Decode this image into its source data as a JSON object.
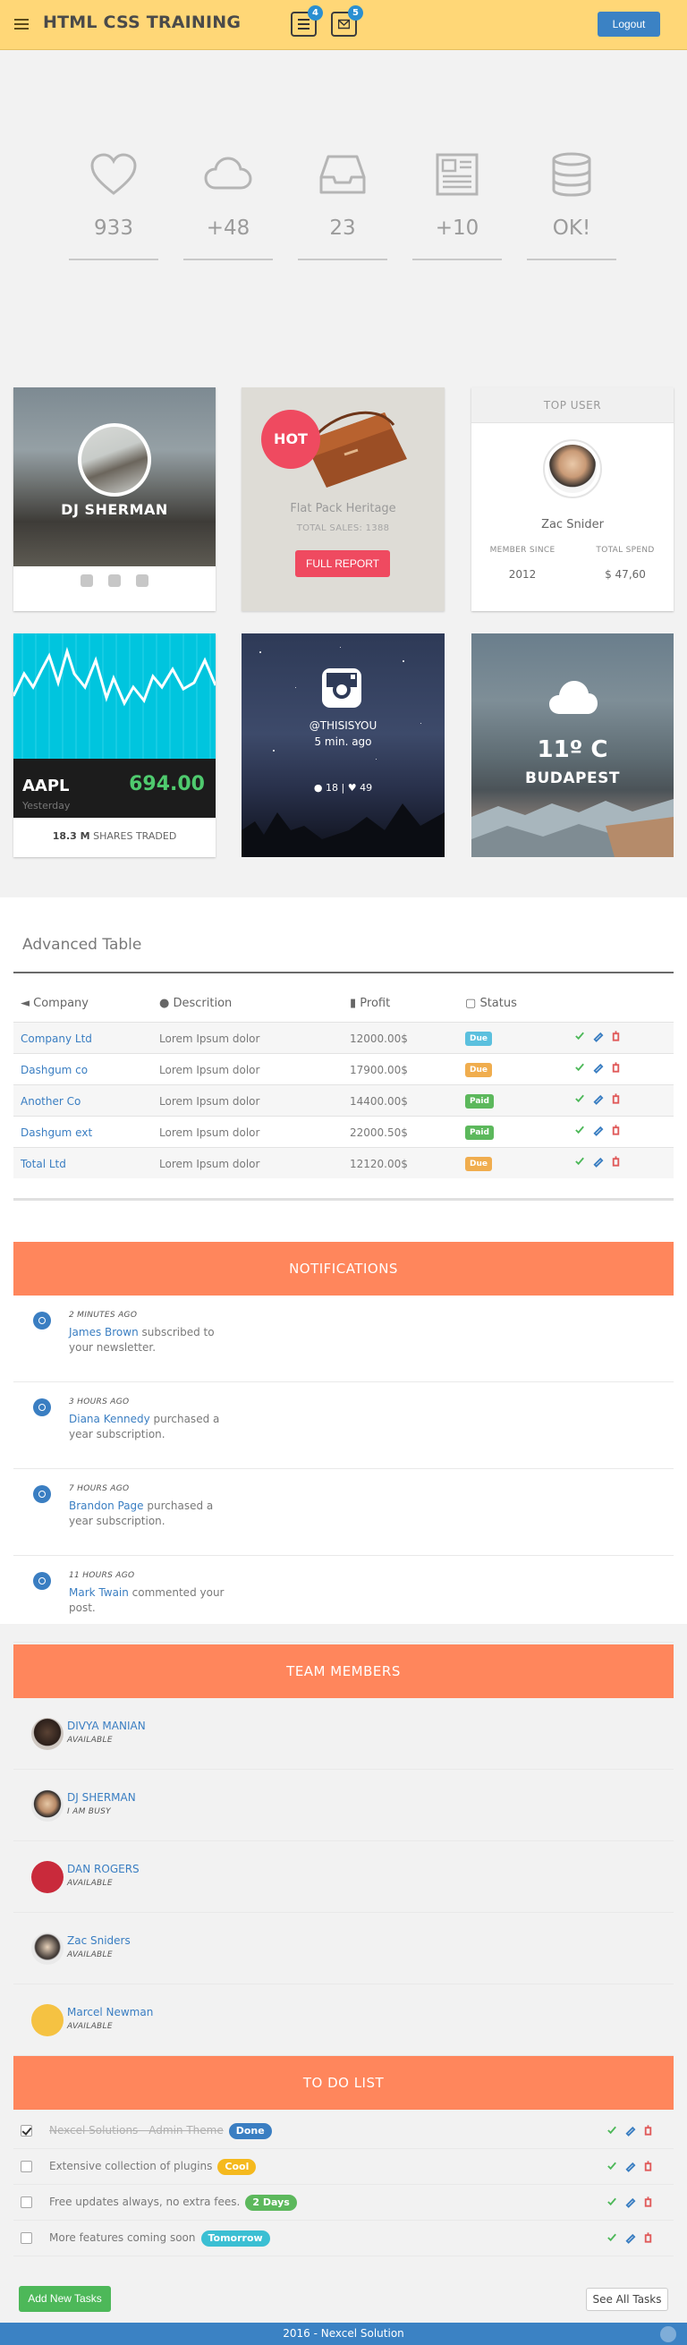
{
  "header": {
    "title": "HTML CSS TRAINING",
    "tasks_count": "4",
    "mail_count": "5",
    "logout_label": "Logout"
  },
  "stats": [
    {
      "icon": "heart-icon",
      "value": "933"
    },
    {
      "icon": "cloud-icon",
      "value": "+48"
    },
    {
      "icon": "inbox-icon",
      "value": "23"
    },
    {
      "icon": "newspaper-icon",
      "value": "+10"
    },
    {
      "icon": "database-icon",
      "value": "OK!"
    }
  ],
  "profile": {
    "name": "DJ SHERMAN"
  },
  "product": {
    "badge": "HOT",
    "title": "Flat Pack Heritage",
    "sales": "TOTAL SALES: 1388",
    "button": "FULL REPORT"
  },
  "top_user": {
    "header": "TOP USER",
    "name": "Zac Snider",
    "member_since_label": "MEMBER SINCE",
    "member_since": "2012",
    "total_spend_label": "TOTAL SPEND",
    "total_spend": "$ 47,60"
  },
  "stock": {
    "symbol": "AAPL",
    "price": "694.00",
    "period": "Yesterday",
    "shares_value": "18.3 M",
    "shares_label": "SHARES TRADED"
  },
  "instagram": {
    "handle": "@THISISYOU",
    "time": "5 min. ago",
    "comments": "18",
    "likes": "49"
  },
  "weather": {
    "temp": "11º C",
    "city": "BUDAPEST"
  },
  "table": {
    "title": "Advanced Table",
    "headers": [
      "Company",
      "Descrition",
      "Profit",
      "Status"
    ],
    "rows": [
      {
        "company": "Company Ltd",
        "desc": "Lorem Ipsum dolor",
        "profit": "12000.00$",
        "status": "Due",
        "color": "#5bc0de"
      },
      {
        "company": "Dashgum co",
        "desc": "Lorem Ipsum dolor",
        "profit": "17900.00$",
        "status": "Due",
        "color": "#f0ad4e"
      },
      {
        "company": "Another Co",
        "desc": "Lorem Ipsum dolor",
        "profit": "14400.00$",
        "status": "Paid",
        "color": "#5cb85c"
      },
      {
        "company": "Dashgum ext",
        "desc": "Lorem Ipsum dolor",
        "profit": "22000.50$",
        "status": "Paid",
        "color": "#5cb85c"
      },
      {
        "company": "Total Ltd",
        "desc": "Lorem Ipsum dolor",
        "profit": "12120.00$",
        "status": "Due",
        "color": "#f0ad4e"
      }
    ]
  },
  "notifications": {
    "title": "NOTIFICATIONS",
    "items": [
      {
        "time": "2 MINUTES AGO",
        "name": "James Brown",
        "text": " subscribed to your newsletter."
      },
      {
        "time": "3 HOURS AGO",
        "name": "Diana Kennedy",
        "text": " purchased a year subscription."
      },
      {
        "time": "7 HOURS AGO",
        "name": "Brandon Page",
        "text": " purchased a year subscription."
      },
      {
        "time": "11 HOURS AGO",
        "name": "Mark Twain",
        "text": " commented your post."
      }
    ]
  },
  "team": {
    "title": "TEAM MEMBERS",
    "members": [
      {
        "name": "DIVYA MANIAN",
        "status": "AVAILABLE"
      },
      {
        "name": "DJ SHERMAN",
        "status": "I AM BUSY"
      },
      {
        "name": "DAN ROGERS",
        "status": "AVAILABLE"
      },
      {
        "name": "Zac Sniders",
        "status": "AVAILABLE"
      },
      {
        "name": "Marcel Newman",
        "status": "AVAILABLE"
      }
    ]
  },
  "todo": {
    "title": "TO DO LIST",
    "items": [
      {
        "text": "Nexcel Solutions - Admin Theme",
        "badge": "Done",
        "color": "#3a7ec2",
        "checked": true
      },
      {
        "text": "Extensive collection of plugins",
        "badge": "Cool",
        "color": "#f5b91e",
        "checked": false
      },
      {
        "text": "Free updates always, no extra fees.",
        "badge": "2 Days",
        "color": "#5cb85c",
        "checked": false
      },
      {
        "text": "More features coming soon",
        "badge": "Tomorrow",
        "color": "#3bbfd3",
        "checked": false
      }
    ],
    "add_label": "Add New Tasks",
    "see_all_label": "See All Tasks"
  },
  "footer": {
    "text": "2016 - Nexcel Solution"
  }
}
